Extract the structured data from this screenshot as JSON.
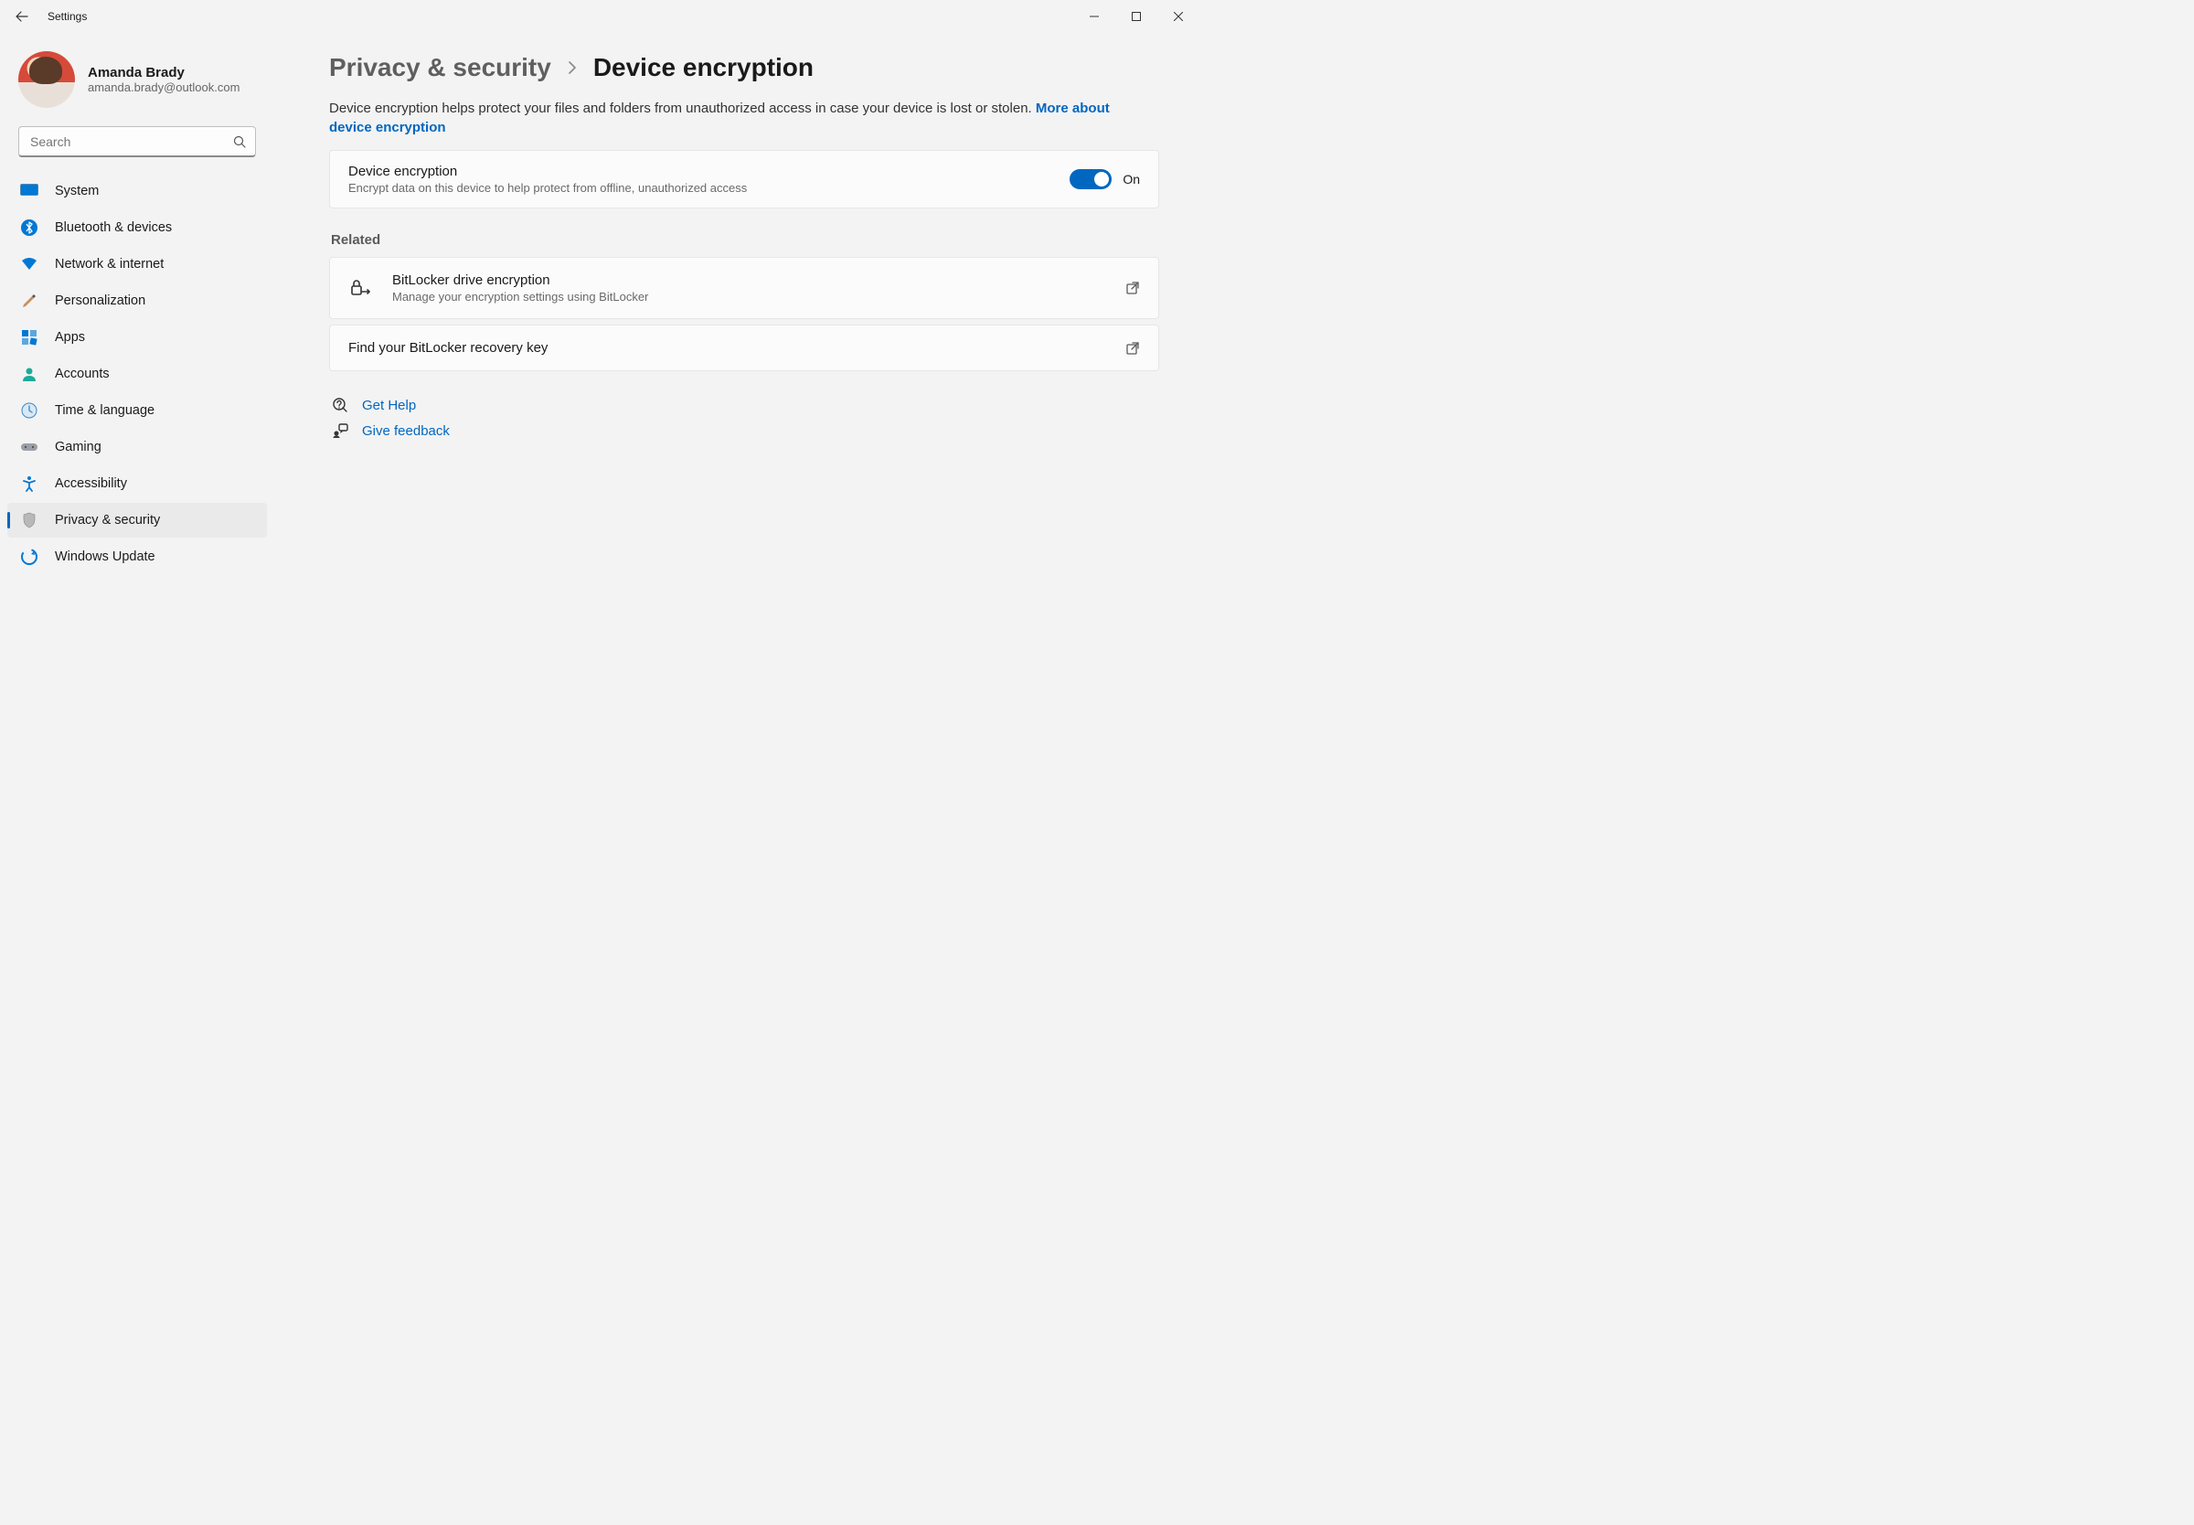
{
  "window": {
    "title": "Settings"
  },
  "user": {
    "name": "Amanda Brady",
    "email": "amanda.brady@outlook.com"
  },
  "search": {
    "placeholder": "Search"
  },
  "nav": {
    "items": [
      {
        "label": "System"
      },
      {
        "label": "Bluetooth & devices"
      },
      {
        "label": "Network & internet"
      },
      {
        "label": "Personalization"
      },
      {
        "label": "Apps"
      },
      {
        "label": "Accounts"
      },
      {
        "label": "Time & language"
      },
      {
        "label": "Gaming"
      },
      {
        "label": "Accessibility"
      },
      {
        "label": "Privacy & security"
      },
      {
        "label": "Windows Update"
      }
    ]
  },
  "breadcrumb": {
    "parent": "Privacy & security",
    "current": "Device encryption"
  },
  "intro": {
    "text": "Device encryption helps protect your files and folders from unauthorized access in case your device is lost or stolen. ",
    "link": "More about device encryption"
  },
  "toggleCard": {
    "title": "Device encryption",
    "sub": "Encrypt data on this device to help protect from offline, unauthorized access",
    "stateLabel": "On"
  },
  "related": {
    "header": "Related",
    "bitlocker": {
      "title": "BitLocker drive encryption",
      "sub": "Manage your encryption settings using BitLocker"
    },
    "recovery": {
      "title": "Find your BitLocker recovery key"
    }
  },
  "footer": {
    "help": "Get Help",
    "feedback": "Give feedback"
  }
}
